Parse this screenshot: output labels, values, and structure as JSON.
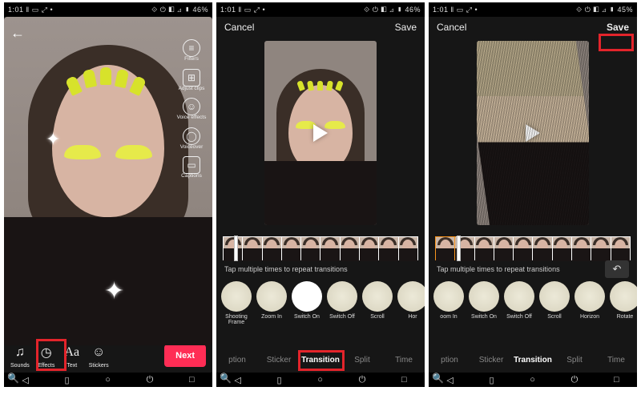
{
  "status": {
    "time1": "1:01",
    "time2": "1:01",
    "time3": "1:01",
    "left_icons": "‖ ▭ ⤢ •",
    "right1": "⟐ ⏻ ◧ ⊿ ▮ 46%",
    "right2": "⟐ ⏻ ◧ ⊿ ▮ 46%",
    "right3": "⟐ ⏻ ◧ ⊿ ▮ 45%"
  },
  "screen1": {
    "side": [
      {
        "icon": "≡",
        "label": "Filters"
      },
      {
        "icon": "⊞",
        "label": "Adjust clips"
      },
      {
        "icon": "☺",
        "label": "Voice effects"
      },
      {
        "icon": "◯",
        "label": "Voiceover"
      },
      {
        "icon": "▭",
        "label": "Captions"
      }
    ],
    "bottom": {
      "sounds": "Sounds",
      "effects": "Effects",
      "text": "Text",
      "stickers": "Stickers",
      "next": "Next"
    }
  },
  "editor": {
    "cancel": "Cancel",
    "save": "Save",
    "hint": "Tap multiple times to repeat transitions",
    "undo_icon": "↶",
    "fx2": [
      {
        "label": "Shooting Frame"
      },
      {
        "label": "Zoom In"
      },
      {
        "label": "Switch On",
        "selected": true
      },
      {
        "label": "Switch Off"
      },
      {
        "label": "Scroll"
      },
      {
        "label": "Hor"
      }
    ],
    "fx3": [
      {
        "label": "oom In"
      },
      {
        "label": "Switch On"
      },
      {
        "label": "Switch Off"
      },
      {
        "label": "Scroll"
      },
      {
        "label": "Horizon"
      },
      {
        "label": "Rotate"
      }
    ],
    "tabs": [
      "ption",
      "Sticker",
      "Transition",
      "Split",
      "Time"
    ],
    "active_tab": "Transition"
  }
}
